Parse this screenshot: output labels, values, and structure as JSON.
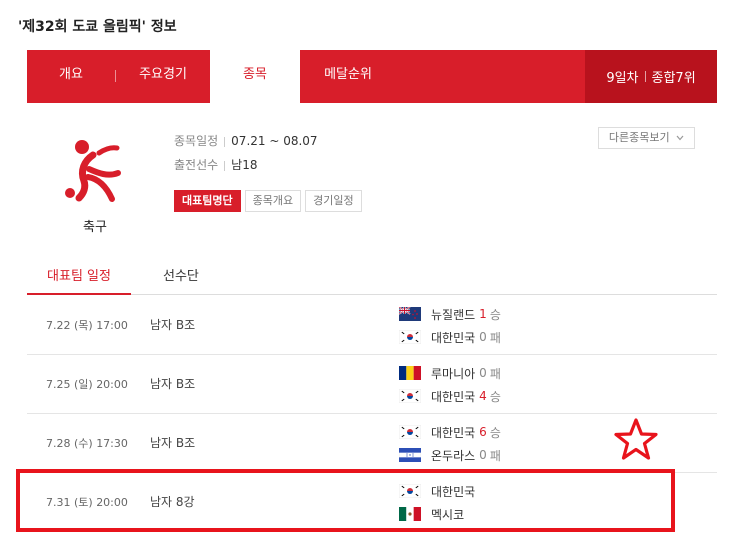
{
  "page": {
    "title": "'제32회 도쿄 올림픽' 정보"
  },
  "tabs": [
    {
      "label": "개요"
    },
    {
      "label": "주요경기"
    },
    {
      "label": "종목"
    },
    {
      "label": "메달순위"
    }
  ],
  "rank": {
    "day": "9일차",
    "overall": "종합7위"
  },
  "sport": {
    "icon": "soccer-pictogram-icon",
    "name": "축구",
    "schedule_label": "종목일정",
    "schedule_value": "07.21 ~ 08.07",
    "athletes_label": "출전선수",
    "athletes_value": "남18",
    "other_sports": "다른종목보기"
  },
  "buttons": {
    "roster": "대표팀명단",
    "overview": "종목개요",
    "schedule": "경기일정"
  },
  "subtabs": [
    {
      "label": "대표팀 일정"
    },
    {
      "label": "선수단"
    }
  ],
  "matches": [
    {
      "date": "7.22 (목) 17:00",
      "event": "남자 B조",
      "team1": {
        "name": "뉴질랜드",
        "score": "1",
        "result": "승",
        "flag": "new-zealand-flag-icon"
      },
      "team2": {
        "name": "대한민국",
        "score": "0",
        "result": "패",
        "flag": "korea-flag-icon"
      }
    },
    {
      "date": "7.25 (일) 20:00",
      "event": "남자 B조",
      "team1": {
        "name": "루마니아",
        "score": "0",
        "result": "패",
        "flag": "romania-flag-icon"
      },
      "team2": {
        "name": "대한민국",
        "score": "4",
        "result": "승",
        "flag": "korea-flag-icon"
      }
    },
    {
      "date": "7.28 (수) 17:30",
      "event": "남자 B조",
      "team1": {
        "name": "대한민국",
        "score": "6",
        "result": "승",
        "flag": "korea-flag-icon"
      },
      "team2": {
        "name": "온두라스",
        "score": "0",
        "result": "패",
        "flag": "honduras-flag-icon"
      }
    },
    {
      "date": "7.31 (토) 20:00",
      "event": "남자 8강",
      "team1": {
        "name": "대한민국",
        "flag": "korea-flag-icon"
      },
      "team2": {
        "name": "멕시코",
        "flag": "mexico-flag-icon"
      }
    }
  ],
  "colors": {
    "brand_red": "#d81e2a",
    "highlight_red": "#e8141c"
  }
}
